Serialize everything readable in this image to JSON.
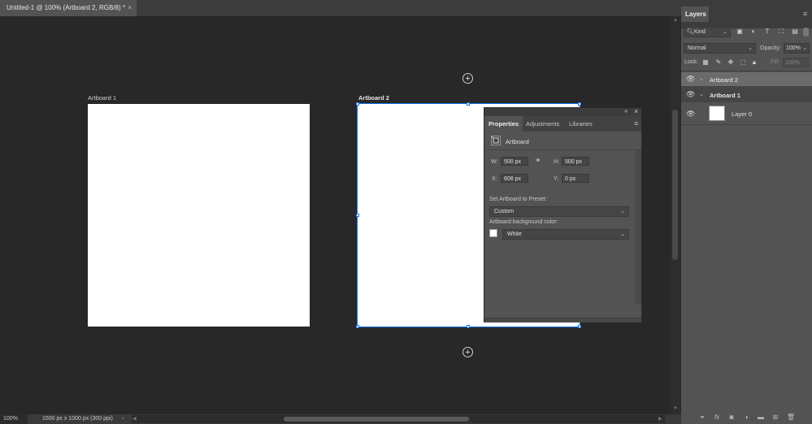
{
  "document": {
    "tab_title": "Untitled-1 @ 100% (Artboard 2, RGB/8) *",
    "close_glyph": "×"
  },
  "canvas": {
    "artboard1_label": "Artboard 1",
    "artboard2_label": "Artboard 2",
    "add_artboard_glyph": "+"
  },
  "status": {
    "zoom": "100%",
    "doc_info": "1500 px x 1000 px (300 ppi)",
    "arrow": "›"
  },
  "properties": {
    "tabs": [
      {
        "label": "Properties",
        "active": true
      },
      {
        "label": "Adjustments",
        "active": false
      },
      {
        "label": "Libraries",
        "active": false
      }
    ],
    "section_title": "Artboard",
    "w_label": "W:",
    "w_value": "500 px",
    "h_label": "H:",
    "h_value": "500 px",
    "x_label": "X:",
    "x_value": "608 px",
    "y_label": "Y:",
    "y_value": "0 px",
    "preset_label": "Set Artboard to Preset:",
    "preset_value": "Custom",
    "bg_label": "Artboard background color:",
    "bg_value": "White",
    "bg_swatch_color": "#ffffff",
    "collapse_glyph": "«",
    "close_glyph": "×",
    "menu_glyph": "≡"
  },
  "layers": {
    "tab_label": "Layers",
    "filter_kind": "Kind",
    "blend_mode": "Normal",
    "opacity_label": "Opacity:",
    "opacity_value": "100%",
    "lock_label": "Lock:",
    "fill_label": "Fill:",
    "fill_value": "100%",
    "rows": [
      {
        "name": "Artboard 2",
        "selected": true
      },
      {
        "name": "Artboard 1",
        "selected": false
      },
      {
        "name": "Layer 0",
        "selected": false
      }
    ],
    "menu_glyph": "≡"
  },
  "colors": {
    "selection_blue": "#1473e6",
    "panel_bg": "#535353",
    "canvas_bg": "#282828"
  }
}
